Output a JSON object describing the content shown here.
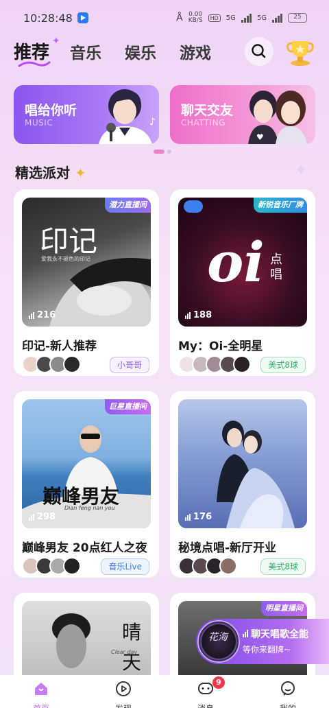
{
  "status_bar": {
    "time": "10:28:48",
    "net_speed": "0.00\nKB/S",
    "hd": "HD",
    "signal1": "5G",
    "signal2": "5G",
    "battery": "25"
  },
  "top_nav": {
    "tabs": [
      {
        "label": "推荐",
        "active": true
      },
      {
        "label": "音乐",
        "active": false
      },
      {
        "label": "娱乐",
        "active": false
      },
      {
        "label": "游戏",
        "active": false
      }
    ],
    "search_icon": "search-icon",
    "trophy_icon": "trophy-icon"
  },
  "banners": [
    {
      "title": "唱给你听",
      "subtitle": "MUSIC",
      "color": "#8a56ef"
    },
    {
      "title": "聊天交友",
      "subtitle": "CHATTING",
      "color": "#ee6ec9"
    }
  ],
  "carousel": {
    "pages": 2,
    "current": 1
  },
  "section": {
    "title": "精选派对"
  },
  "rooms": [
    {
      "title": "印记-新人推荐",
      "listeners": "216",
      "tag": "潜力直播间",
      "badge": "小哥哥",
      "badge_style": "purple",
      "cover_text": "印记",
      "cover_caption": "爱我永不褪色的印记"
    },
    {
      "title": "My：Oi-全明星",
      "listeners": "188",
      "tag": "新锐音乐厂牌",
      "badge": "美式8球",
      "badge_style": "green",
      "cover_text": "oi",
      "cover_caption": "点唱"
    },
    {
      "title": "巅峰男友 20点红人之夜",
      "listeners": "298",
      "tag": "巨星直播间",
      "badge": "音乐Live",
      "badge_style": "blue",
      "cover_text": "巅峰男友",
      "cover_caption": "Dian feng nan you"
    },
    {
      "title": "秘境点唱-新厅开业",
      "listeners": "176",
      "tag": "",
      "badge": "美式8球",
      "badge_style": "green",
      "cover_text": "",
      "cover_caption": ""
    },
    {
      "title": "",
      "listeners": "",
      "tag": "",
      "badge": "",
      "badge_style": "",
      "cover_text": "晴天",
      "cover_caption": "Clear day"
    },
    {
      "title": "",
      "listeners": "",
      "tag": "明星直播间",
      "badge": "",
      "badge_style": "",
      "cover_text": "",
      "cover_caption": ""
    }
  ],
  "float_promo": {
    "line1": "聊天唱歌全能",
    "line2": "等你来翻牌~",
    "disc_text": "花海"
  },
  "bottom_nav": {
    "items": [
      {
        "label": "首页",
        "icon": "home-icon",
        "active": true
      },
      {
        "label": "发现",
        "icon": "discover-icon",
        "active": false
      },
      {
        "label": "消息",
        "icon": "message-icon",
        "active": false,
        "badge": "9"
      },
      {
        "label": "我的",
        "icon": "profile-icon",
        "active": false
      }
    ]
  }
}
